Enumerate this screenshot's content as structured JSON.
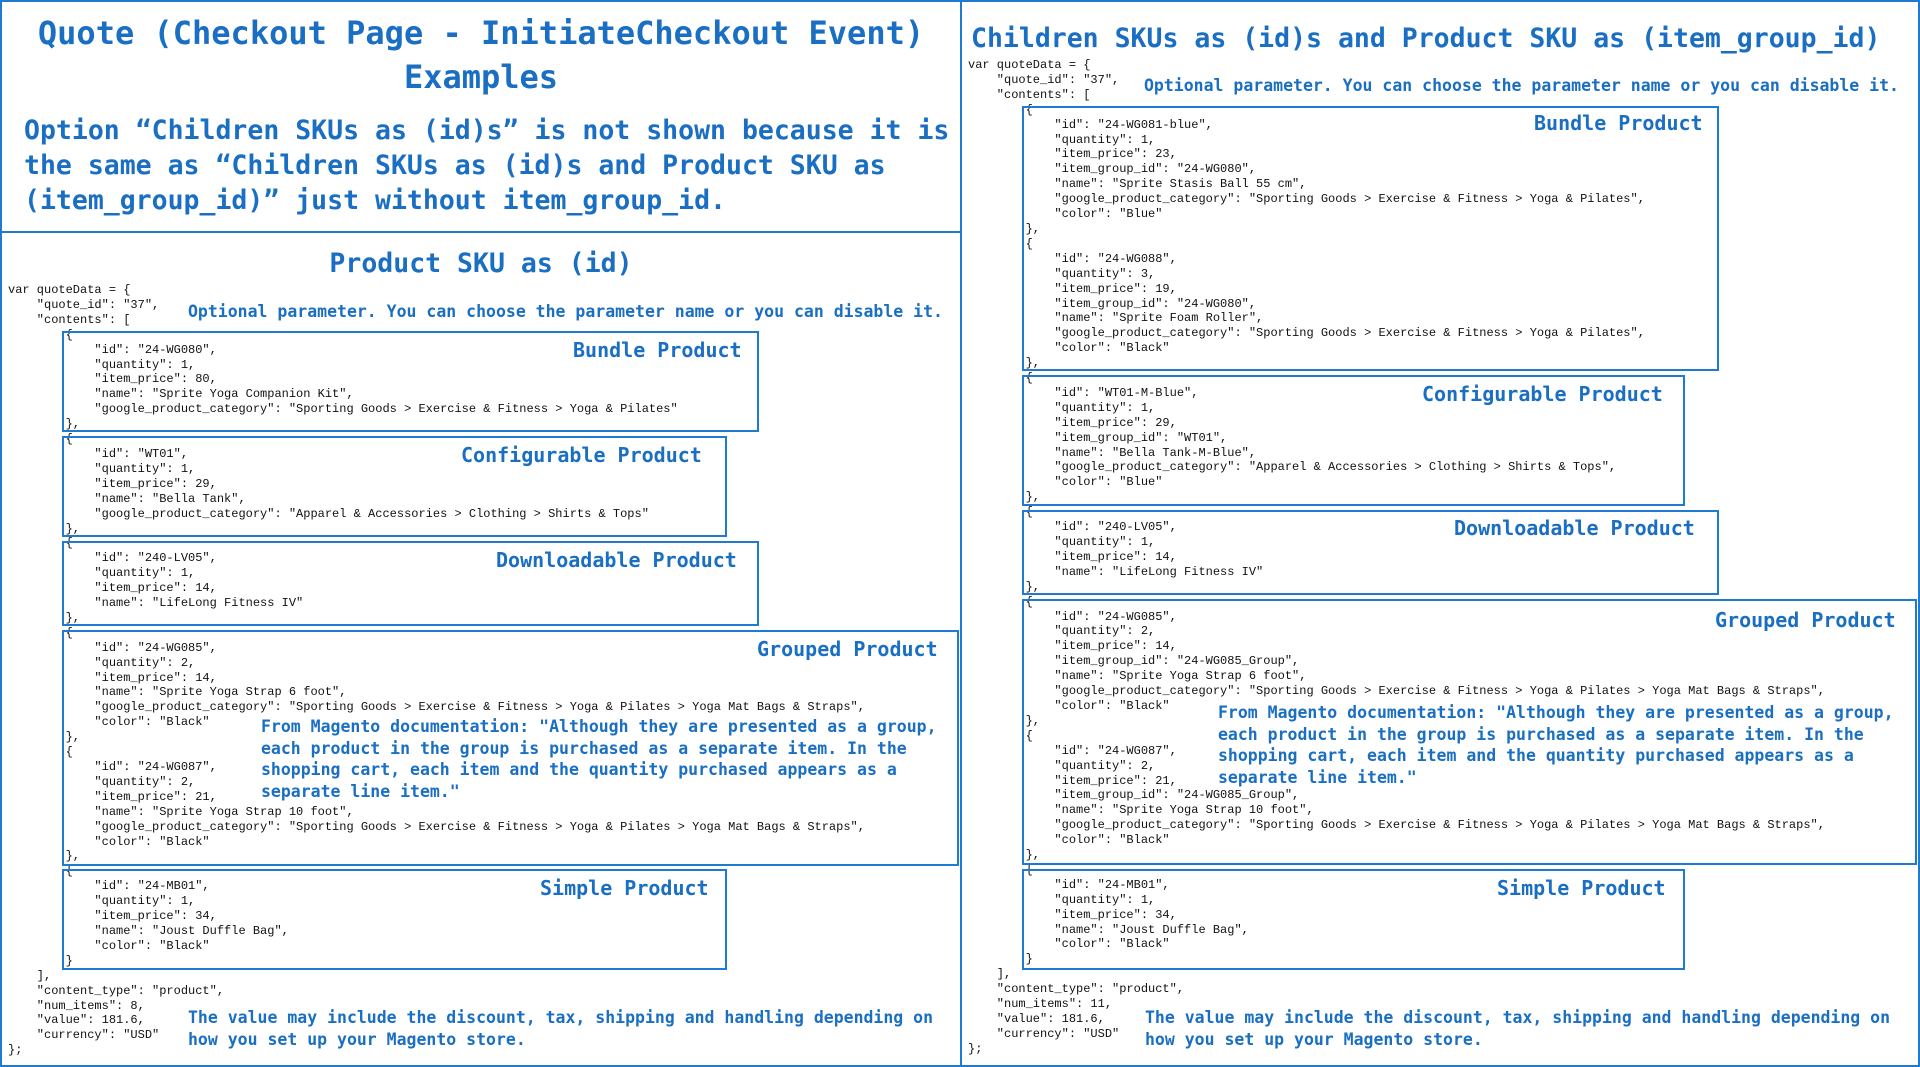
{
  "header": {
    "title_line1": "Quote (Checkout Page - InitiateCheckout Event)",
    "title_line2": "Examples",
    "desc_line1": "Option “Children SKUs as (id)s” is not shown because it is",
    "desc_line2": "the same as “Children SKUs as (id)s and Product SKU as",
    "desc_line3": "(item_group_id)” just without item_group_id."
  },
  "left": {
    "title": "Product SKU as (id)",
    "code": [
      "var quoteData = {",
      "    \"quote_id\": \"37\",",
      "    \"contents\": [",
      "        {",
      "            \"id\": \"24-WG080\",",
      "            \"quantity\": 1,",
      "            \"item_price\": 80,",
      "            \"name\": \"Sprite Yoga Companion Kit\",",
      "            \"google_product_category\": \"Sporting Goods > Exercise & Fitness > Yoga & Pilates\"",
      "        },",
      "        {",
      "            \"id\": \"WT01\",",
      "            \"quantity\": 1,",
      "            \"item_price\": 29,",
      "            \"name\": \"Bella Tank\",",
      "            \"google_product_category\": \"Apparel & Accessories > Clothing > Shirts & Tops\"",
      "        },",
      "        {",
      "            \"id\": \"240-LV05\",",
      "            \"quantity\": 1,",
      "            \"item_price\": 14,",
      "            \"name\": \"LifeLong Fitness IV\"",
      "        },",
      "        {",
      "            \"id\": \"24-WG085\",",
      "            \"quantity\": 2,",
      "            \"item_price\": 14,",
      "            \"name\": \"Sprite Yoga Strap 6 foot\",",
      "            \"google_product_category\": \"Sporting Goods > Exercise & Fitness > Yoga & Pilates > Yoga Mat Bags & Straps\",",
      "            \"color\": \"Black\"",
      "        },",
      "        {",
      "            \"id\": \"24-WG087\",",
      "            \"quantity\": 2,",
      "            \"item_price\": 21,",
      "            \"name\": \"Sprite Yoga Strap 10 foot\",",
      "            \"google_product_category\": \"Sporting Goods > Exercise & Fitness > Yoga & Pilates > Yoga Mat Bags & Straps\",",
      "            \"color\": \"Black\"",
      "        },",
      "        {",
      "            \"id\": \"24-MB01\",",
      "            \"quantity\": 1,",
      "            \"item_price\": 34,",
      "            \"name\": \"Joust Duffle Bag\",",
      "            \"color\": \"Black\"",
      "        }",
      "    ],",
      "    \"content_type\": \"product\",",
      "    \"num_items\": 8,",
      "    \"value\": 181.6,",
      "    \"currency\": \"USD\"",
      "};"
    ],
    "optional_note": "Optional parameter. You can choose the parameter name or you can disable it.",
    "labels": {
      "bundle": "Bundle Product",
      "configurable": "Configurable Product",
      "downloadable": "Downloadable Product",
      "grouped": "Grouped Product",
      "simple": "Simple Product"
    },
    "grouped_note": "From Magento documentation: \"Although they are presented as a group,\neach product in the group is purchased as a separate item. In the\nshopping cart, each item and the quantity purchased appears as a\nseparate line item.\"",
    "value_note": "The value may include the discount, tax, shipping and handling depending on\nhow you set up your Magento store."
  },
  "right": {
    "title": "Children SKUs as (id)s and Product SKU as (item_group_id)",
    "code": [
      "var quoteData = {",
      "    \"quote_id\": \"37\",",
      "    \"contents\": [",
      "        {",
      "            \"id\": \"24-WG081-blue\",",
      "            \"quantity\": 1,",
      "            \"item_price\": 23,",
      "            \"item_group_id\": \"24-WG080\",",
      "            \"name\": \"Sprite Stasis Ball 55 cm\",",
      "            \"google_product_category\": \"Sporting Goods > Exercise & Fitness > Yoga & Pilates\",",
      "            \"color\": \"Blue\"",
      "        },",
      "        {",
      "            \"id\": \"24-WG088\",",
      "            \"quantity\": 3,",
      "            \"item_price\": 19,",
      "            \"item_group_id\": \"24-WG080\",",
      "            \"name\": \"Sprite Foam Roller\",",
      "            \"google_product_category\": \"Sporting Goods > Exercise & Fitness > Yoga & Pilates\",",
      "            \"color\": \"Black\"",
      "        },",
      "        {",
      "            \"id\": \"WT01-M-Blue\",",
      "            \"quantity\": 1,",
      "            \"item_price\": 29,",
      "            \"item_group_id\": \"WT01\",",
      "            \"name\": \"Bella Tank-M-Blue\",",
      "            \"google_product_category\": \"Apparel & Accessories > Clothing > Shirts & Tops\",",
      "            \"color\": \"Blue\"",
      "        },",
      "        {",
      "            \"id\": \"240-LV05\",",
      "            \"quantity\": 1,",
      "            \"item_price\": 14,",
      "            \"name\": \"LifeLong Fitness IV\"",
      "        },",
      "        {",
      "            \"id\": \"24-WG085\",",
      "            \"quantity\": 2,",
      "            \"item_price\": 14,",
      "            \"item_group_id\": \"24-WG085_Group\",",
      "            \"name\": \"Sprite Yoga Strap 6 foot\",",
      "            \"google_product_category\": \"Sporting Goods > Exercise & Fitness > Yoga & Pilates > Yoga Mat Bags & Straps\",",
      "            \"color\": \"Black\"",
      "        },",
      "        {",
      "            \"id\": \"24-WG087\",",
      "            \"quantity\": 2,",
      "            \"item_price\": 21,",
      "            \"item_group_id\": \"24-WG085_Group\",",
      "            \"name\": \"Sprite Yoga Strap 10 foot\",",
      "            \"google_product_category\": \"Sporting Goods > Exercise & Fitness > Yoga & Pilates > Yoga Mat Bags & Straps\",",
      "            \"color\": \"Black\"",
      "        },",
      "        {",
      "            \"id\": \"24-MB01\",",
      "            \"quantity\": 1,",
      "            \"item_price\": 34,",
      "            \"name\": \"Joust Duffle Bag\",",
      "            \"color\": \"Black\"",
      "        }",
      "    ],",
      "    \"content_type\": \"product\",",
      "    \"num_items\": 11,",
      "    \"value\": 181.6,",
      "    \"currency\": \"USD\"",
      "};"
    ],
    "optional_note": "Optional parameter. You can choose the parameter name or you can disable it.",
    "labels": {
      "bundle": "Bundle Product",
      "configurable": "Configurable Product",
      "downloadable": "Downloadable Product",
      "grouped": "Grouped Product",
      "simple": "Simple Product"
    },
    "grouped_note": "From Magento documentation: \"Although they are presented as a group,\neach product in the group is purchased as a separate item. In the\nshopping cart, each item and the quantity purchased appears as a\nseparate line item.\"",
    "value_note": "The value may include the discount, tax, shipping and handling depending on\nhow you set up your Magento store."
  }
}
